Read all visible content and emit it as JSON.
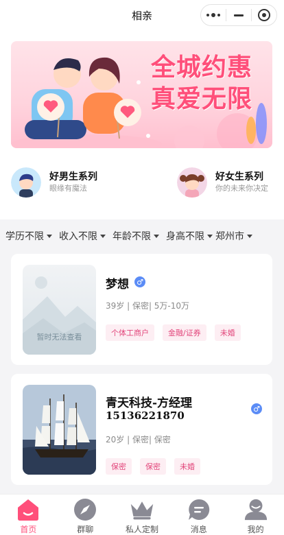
{
  "header": {
    "title": "相亲"
  },
  "banner": {
    "line1": "全城约惠",
    "line2": "真爱无限"
  },
  "series": [
    {
      "name": "好男生系列",
      "sub": "眼缘有魔法"
    },
    {
      "name": "好女生系列",
      "sub": "你的未来你决定"
    }
  ],
  "filters": [
    {
      "label": "学历不限"
    },
    {
      "label": "收入不限"
    },
    {
      "label": "年龄不限"
    },
    {
      "label": "身高不限"
    },
    {
      "label": "郑州市"
    }
  ],
  "cards": [
    {
      "name": "梦想",
      "gender_icon": "♂",
      "info": "39岁 | 保密| 5万-10万",
      "photo_text": "暂时无法查看",
      "tags": [
        "个体工商户",
        "金融/证券",
        "未婚"
      ]
    },
    {
      "name": "青天科技-方经理",
      "phone": "15136221870",
      "gender_icon": "♂",
      "info": "20岁 | 保密| 保密",
      "tags": [
        "保密",
        "保密",
        "未婚"
      ]
    }
  ],
  "tabbar": {
    "items": [
      {
        "label": "首页",
        "icon": "home-icon",
        "active": true
      },
      {
        "label": "群聊",
        "icon": "compass-icon",
        "active": false
      },
      {
        "label": "私人定制",
        "icon": "crown-icon",
        "active": false
      },
      {
        "label": "消息",
        "icon": "message-icon",
        "active": false
      },
      {
        "label": "我的",
        "icon": "user-icon",
        "active": false
      }
    ]
  },
  "colors": {
    "accent": "#ff4f7a",
    "tag_bg": "#fdeef3",
    "tag_text": "#e2467b",
    "male": "#5b8cf6"
  }
}
